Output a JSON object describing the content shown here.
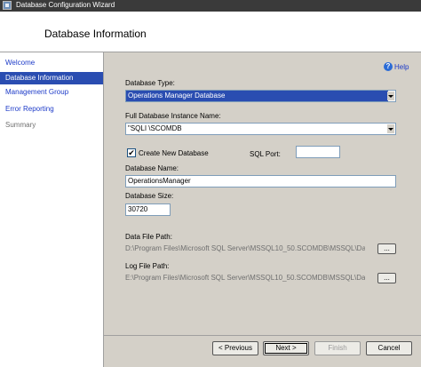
{
  "window": {
    "title": "Database Configuration Wizard"
  },
  "header": {
    "title": "Database Information"
  },
  "sidebar": {
    "items": [
      {
        "label": "Welcome",
        "state": "link"
      },
      {
        "label": "Database Information",
        "state": "active"
      },
      {
        "label": "Management Group",
        "state": "link"
      },
      {
        "label": "Error Reporting",
        "state": "link"
      },
      {
        "label": "Summary",
        "state": "disabled"
      }
    ]
  },
  "help": {
    "label": "Help",
    "icon": "help-icon"
  },
  "form": {
    "database_type": {
      "label": "Database Type:",
      "value": "Operations Manager Database"
    },
    "instance_name": {
      "label": "Full Database Instance Name:",
      "value": "   \"SQLI     \\SCOMDB"
    },
    "create_new_database": {
      "label": "Create New Database",
      "checked": true,
      "mark": "✔"
    },
    "sql_port": {
      "label": "SQL Port:",
      "value": ""
    },
    "database_name": {
      "label": "Database Name:",
      "value": "OperationsManager"
    },
    "database_size": {
      "label": "Database Size:",
      "value": "30720"
    },
    "data_file_path": {
      "label": "Data File Path:",
      "value": "D:\\Program Files\\Microsoft SQL Server\\MSSQL10_50.SCOMDB\\MSSQL\\Data",
      "browse_label": "..."
    },
    "log_file_path": {
      "label": "Log File Path:",
      "value": "E:\\Program Files\\Microsoft SQL Server\\MSSQL10_50.SCOMDB\\MSSQL\\Data",
      "browse_label": "..."
    }
  },
  "buttons": {
    "previous": "< Previous",
    "next": "Next >",
    "finish": "Finish",
    "cancel": "Cancel"
  },
  "colors": {
    "accent": "#2a4db1",
    "link": "#1c3ac8",
    "background": "#d4d0c8"
  }
}
